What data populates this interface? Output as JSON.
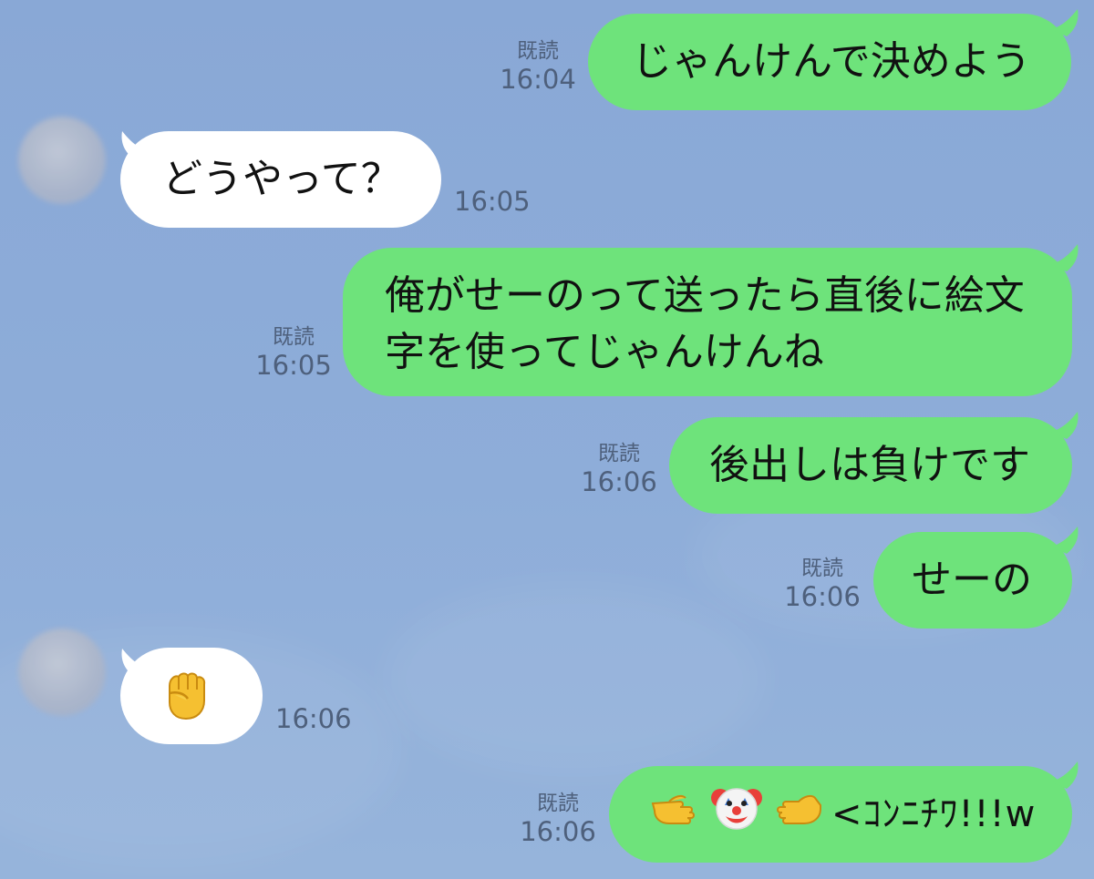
{
  "messages": [
    {
      "id": "m1",
      "direction": "outgoing",
      "text": "じゃんけんで決めよう",
      "read": "既読",
      "time": "16:04"
    },
    {
      "id": "m2",
      "direction": "incoming",
      "text": "どうやって？",
      "time": "16:05"
    },
    {
      "id": "m3",
      "direction": "outgoing",
      "lines": [
        "俺がせーのって送ったら直後に絵文",
        "字を使ってじゃんけんね"
      ],
      "read": "既読",
      "time": "16:05"
    },
    {
      "id": "m4",
      "direction": "outgoing",
      "text": "後出しは負けです",
      "read": "既読",
      "time": "16:06"
    },
    {
      "id": "m5",
      "direction": "outgoing",
      "text": "せーの",
      "read": "既読",
      "time": "16:06"
    },
    {
      "id": "m6",
      "direction": "incoming",
      "emoji": "raised-fist",
      "time": "16:06"
    },
    {
      "id": "m7",
      "direction": "outgoing",
      "emojis": [
        "pointing-hand-right",
        "clown-face",
        "open-hand-left"
      ],
      "text": "<ｺﾝﾆﾁﾜ!!!w",
      "read": "既読",
      "time": "16:06"
    }
  ],
  "colors": {
    "background": "#89a8d6",
    "outgoing_bubble": "#6ee37b",
    "incoming_bubble": "#ffffff",
    "meta_text": "#4e607c"
  }
}
